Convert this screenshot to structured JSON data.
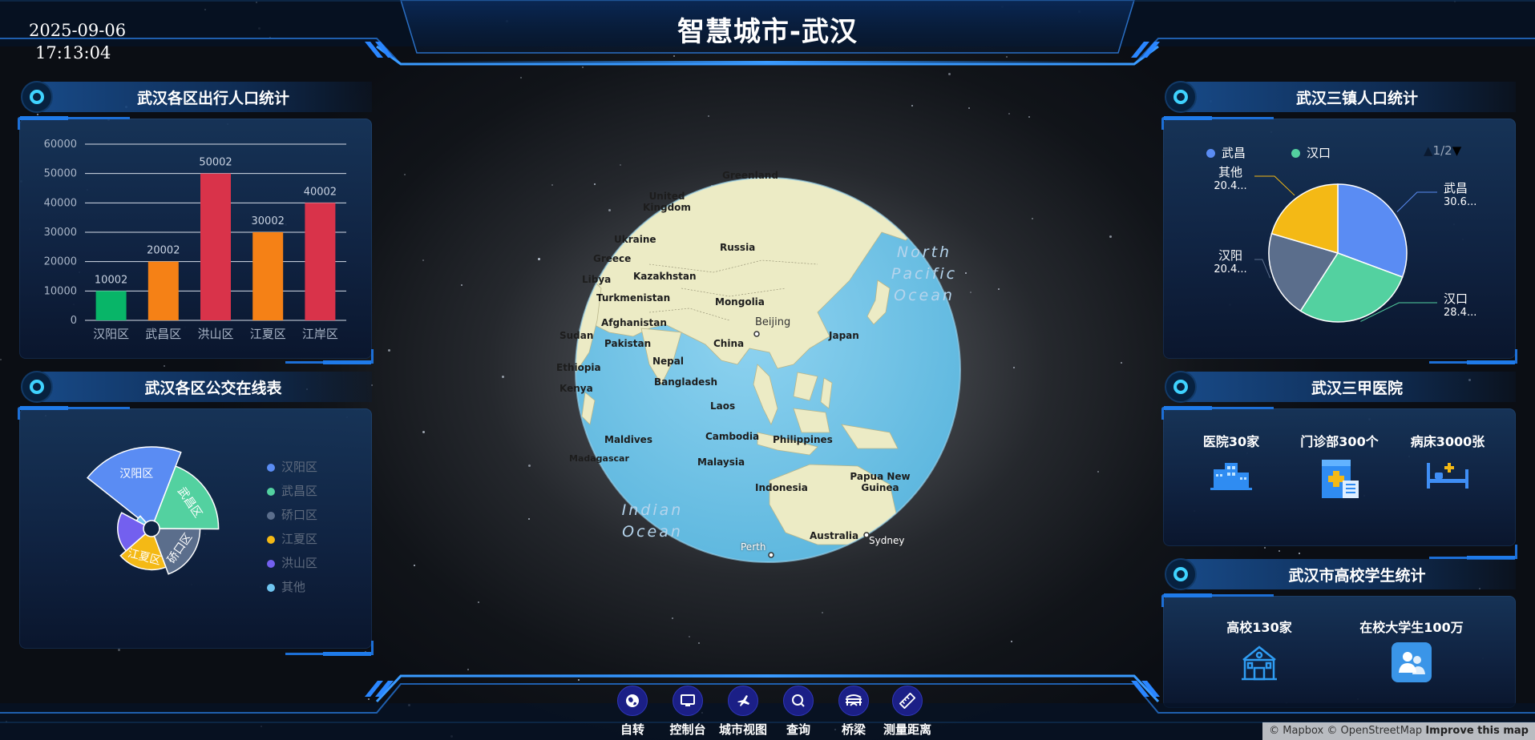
{
  "header": {
    "title": "智慧城市-武汉",
    "date": "2025-09-06",
    "time": "17:13:04"
  },
  "panel_travel": {
    "title": "武汉各区出行人口统计",
    "chart_data": {
      "type": "bar",
      "categories": [
        "汉阳区",
        "武昌区",
        "洪山区",
        "江夏区",
        "江岸区"
      ],
      "values": [
        10002,
        20002,
        50002,
        30002,
        40002
      ],
      "colors": [
        "#08b568",
        "#f58116",
        "#d9334a",
        "#f58116",
        "#d9334a"
      ],
      "yticks": [
        "0",
        "10000",
        "20000",
        "30000",
        "40000",
        "50000",
        "60000"
      ],
      "ylim": [
        0,
        60000
      ]
    }
  },
  "panel_bus": {
    "title": "武汉各区公交在线表",
    "chart_data": {
      "type": "pie",
      "variant": "rose",
      "slice_labels": [
        "汉阳区",
        "武昌区",
        "硚口区",
        "江夏区",
        "洪山区",
        "其他"
      ],
      "colors": [
        "#5a8cf3",
        "#53d1a0",
        "#5b6e8c",
        "#f4b915",
        "#7360ef",
        "#6fc5f0"
      ],
      "values": [
        100,
        80,
        55,
        45,
        35,
        12
      ]
    },
    "legend": [
      "汉阳区",
      "武昌区",
      "硚口区",
      "江夏区",
      "洪山区",
      "其他"
    ]
  },
  "panel_population": {
    "title": "武汉三镇人口统计",
    "legend": [
      {
        "label": "武昌",
        "color": "#5a8cf3"
      },
      {
        "label": "汉口",
        "color": "#53d1a0"
      }
    ],
    "pager": "1/2",
    "chart_data": {
      "type": "pie",
      "slices": [
        {
          "name": "武昌",
          "value": 30.6,
          "label": "30.6...",
          "color": "#5a8cf3"
        },
        {
          "name": "汉口",
          "value": 28.4,
          "label": "28.4...",
          "color": "#53d1a0"
        },
        {
          "name": "汉阳",
          "value": 20.4,
          "label": "20.4...",
          "color": "#5b6e8c"
        },
        {
          "name": "其他",
          "value": 20.4,
          "label": "20.4...",
          "color": "#f4b915"
        }
      ]
    }
  },
  "panel_hospital": {
    "title": "武汉三甲医院",
    "stats": [
      {
        "label": "医院30家",
        "icon": "hospital-building-icon"
      },
      {
        "label": "门诊部300个",
        "icon": "clinic-icon"
      },
      {
        "label": "病床3000张",
        "icon": "bed-icon"
      }
    ]
  },
  "panel_university": {
    "title": "武汉市高校学生统计",
    "stats": [
      {
        "label": "高校130家",
        "icon": "university-icon"
      },
      {
        "label": "在校大学生100万",
        "icon": "students-icon"
      }
    ]
  },
  "map": {
    "labels": [
      "Greenland",
      "United Kingdom",
      "Ukraine",
      "Greece",
      "Libya",
      "Kazakhstan",
      "Russia",
      "Turkmenistan",
      "Mongolia",
      "Afghanistan",
      "Beijing",
      "Japan",
      "Sudan",
      "Pakistan",
      "China",
      "Nepal",
      "Ethiopia",
      "Bangladesh",
      "Kenya",
      "Laos",
      "Maldives",
      "Cambodia",
      "Philippines",
      "Madagascar",
      "Malaysia",
      "Indonesia",
      "Papua New Guinea",
      "Australia",
      "Sydney",
      "Perth"
    ],
    "oceans": [
      "North Pacific Ocean",
      "Indian Ocean"
    ]
  },
  "toolbar": [
    {
      "label": "自转",
      "icon": "globe-icon"
    },
    {
      "label": "控制台",
      "icon": "monitor-icon"
    },
    {
      "label": "城市视图",
      "icon": "plane-icon"
    },
    {
      "label": "查询",
      "icon": "search-icon"
    },
    {
      "label": "桥梁",
      "icon": "bridge-icon"
    },
    {
      "label": "测量距离",
      "icon": "ruler-icon"
    }
  ],
  "attribution": {
    "mapbox": "© Mapbox",
    "osm": "© OpenStreetMap",
    "improve": "Improve this map"
  },
  "colors": {
    "accent": "#1f7bea",
    "panel_bg": "#17365c",
    "cyan": "#3fd3ff"
  }
}
